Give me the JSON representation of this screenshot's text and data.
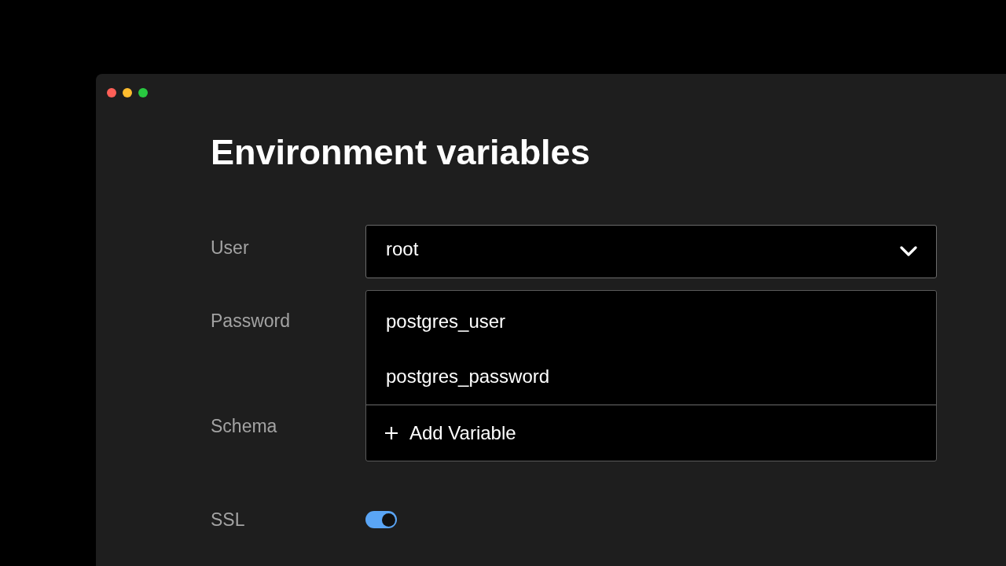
{
  "page": {
    "title": "Environment variables"
  },
  "fields": [
    {
      "label": "User",
      "kind": "select",
      "value": "root",
      "expanded": true,
      "options": [
        "postgres_user",
        "postgres_password"
      ],
      "action": "Add Variable"
    },
    {
      "label": "Password",
      "kind": "covered"
    },
    {
      "label": "Schema",
      "kind": "covered"
    },
    {
      "label": "SSL",
      "kind": "toggle",
      "on": true
    }
  ]
}
